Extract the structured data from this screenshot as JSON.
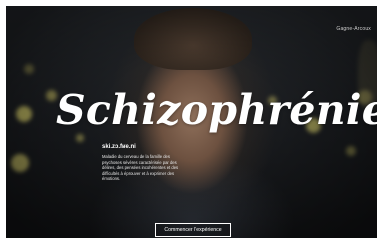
{
  "header": {
    "top_link": "Gagne-Arcoux"
  },
  "hero": {
    "title": "Schizophrénie",
    "subtitle": "ski.zɔ.fʁe.ni",
    "description": "Maladie du cerveau de la famille des psychoses sévères caractérisée par des délires, des pensées incohérentes et des difficultés à éprouver et à exprimer des émotions."
  },
  "cta": {
    "label": "Commencer l'expérience"
  }
}
